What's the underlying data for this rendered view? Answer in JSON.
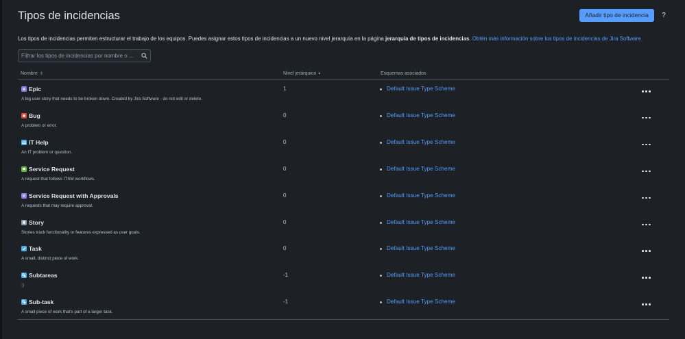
{
  "header": {
    "title": "Tipos de incidencias",
    "add_button": "Añadir tipo de incidencia",
    "help": "?"
  },
  "description": {
    "text_before": "Los tipos de incidencias permiten estructurar el trabajo de los equipos. Puedes asignar estos tipos de incidencias a un nuevo nivel jerarquía en la página ",
    "bold": "jerarquía de tipos de incidencias",
    "text_after": ". ",
    "link": "Obtén más información sobre los tipos de incidencias de Jira Software."
  },
  "search": {
    "placeholder": "Filtrar los tipos de incidencias por nombre o ..."
  },
  "table": {
    "columns": {
      "name": "Nombre",
      "level": "Nivel jerárquico",
      "schemes": "Esquemas asociados"
    },
    "rows": [
      {
        "name": "Epic",
        "desc": "A big user story that needs to be broken down. Created by Jira Software - do not edit or delete.",
        "level": "1",
        "scheme": "Default Issue Type Scheme",
        "icon": "epic-icon",
        "color": "#8f7ee7"
      },
      {
        "name": "Bug",
        "desc": "A problem or error.",
        "level": "0",
        "scheme": "Default Issue Type Scheme",
        "icon": "bug-icon",
        "color": "#e2483d"
      },
      {
        "name": "IT Help",
        "desc": "An IT problem or question.",
        "level": "0",
        "scheme": "Default Issue Type Scheme",
        "icon": "it-help-icon",
        "color": "#4bade8"
      },
      {
        "name": "Service Request",
        "desc": "A request that follows ITSM workflows.",
        "level": "0",
        "scheme": "Default Issue Type Scheme",
        "icon": "service-request-icon",
        "color": "#63ba3c"
      },
      {
        "name": "Service Request with Approvals",
        "desc": "A requests that may require approval.",
        "level": "0",
        "scheme": "Default Issue Type Scheme",
        "icon": "service-request-approvals-icon",
        "color": "#8f7ee7"
      },
      {
        "name": "Story",
        "desc": "Stories track functionality or features expressed as user goals.",
        "level": "0",
        "scheme": "Default Issue Type Scheme",
        "icon": "story-icon",
        "color": "#8c9bab"
      },
      {
        "name": "Task",
        "desc": "A small, distinct piece of work.",
        "level": "0",
        "scheme": "Default Issue Type Scheme",
        "icon": "task-icon",
        "color": "#4bade8"
      },
      {
        "name": "Subtareas",
        "desc": ":)",
        "level": "-1",
        "scheme": "Default Issue Type Scheme",
        "icon": "subtask-icon",
        "color": "#4bade8"
      },
      {
        "name": "Sub-task",
        "desc": "A small piece of work that's part of a larger task.",
        "level": "-1",
        "scheme": "Default Issue Type Scheme",
        "icon": "subtask-icon",
        "color": "#4bade8"
      }
    ]
  }
}
